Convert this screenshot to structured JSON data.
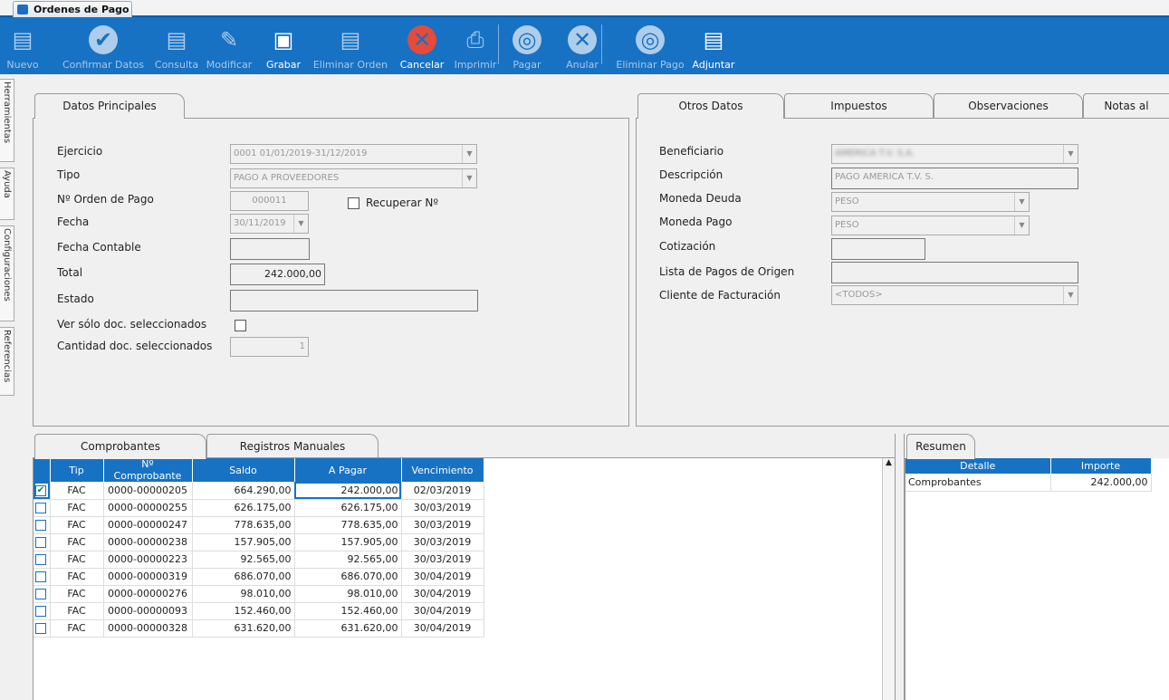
{
  "window": {
    "doc_tab": "Ordenes de Pago"
  },
  "toolbar": [
    {
      "label": "Nuevo",
      "icon": "new-doc-icon",
      "glyph": "▤",
      "enabled": false
    },
    {
      "label": "Confirmar Datos",
      "icon": "check-icon",
      "glyph": "✔",
      "enabled": false
    },
    {
      "label": "Consulta",
      "icon": "query-doc-icon",
      "glyph": "▤",
      "enabled": false
    },
    {
      "label": "Modificar",
      "icon": "edit-icon",
      "glyph": "✎",
      "enabled": false
    },
    {
      "label": "Grabar",
      "icon": "save-icon",
      "glyph": "▣",
      "enabled": true
    },
    {
      "label": "Eliminar Orden",
      "icon": "delete-doc-icon",
      "glyph": "▤",
      "enabled": false
    },
    {
      "label": "Cancelar",
      "icon": "cancel-icon",
      "glyph": "✕",
      "enabled": true
    },
    {
      "label": "Imprimir",
      "icon": "print-icon",
      "glyph": "⎙",
      "enabled": false
    },
    {
      "label": "Pagar",
      "icon": "coins-icon",
      "glyph": "◎",
      "enabled": false
    },
    {
      "label": "Anular",
      "icon": "void-icon",
      "glyph": "✕",
      "enabled": false
    },
    {
      "label": "Eliminar Pago",
      "icon": "delete-pay-icon",
      "glyph": "◎",
      "enabled": false
    },
    {
      "label": "Adjuntar",
      "icon": "attach-icon",
      "glyph": "▤",
      "enabled": true
    }
  ],
  "side_tabs": [
    "Herramientas",
    "Ayuda",
    "Configuraciones",
    "Referencias"
  ],
  "left_panel": {
    "tab": "Datos Principales",
    "labels": {
      "ejercicio": "Ejercicio",
      "tipo": "Tipo",
      "nro": "Nº Orden de Pago",
      "fecha": "Fecha",
      "fecha_contable": "Fecha Contable",
      "total": "Total",
      "estado": "Estado",
      "ver_solo": "Ver sólo doc. seleccionados",
      "cantidad": "Cantidad doc. seleccionados",
      "recuperar": "Recuperar Nº"
    },
    "values": {
      "ejercicio": "0001 01/01/2019-31/12/2019",
      "tipo": "PAGO A PROVEEDORES",
      "nro": "000011",
      "fecha": "30/11/2019",
      "fecha_contable": "",
      "total": "242.000,00",
      "estado": "",
      "cantidad": "1"
    }
  },
  "right_panel": {
    "tabs": [
      "Otros Datos",
      "Impuestos",
      "Observaciones",
      "Notas al"
    ],
    "labels": {
      "beneficiario": "Beneficiario",
      "descripcion": "Descripción",
      "moneda_deuda": "Moneda Deuda",
      "moneda_pago": "Moneda Pago",
      "cotizacion": "Cotización",
      "lista": "Lista de Pagos de Origen",
      "cliente": "Cliente de Facturación"
    },
    "values": {
      "beneficiario": "AMERICA T.V. S.A.",
      "descripcion": "PAGO AMERICA T.V. S.",
      "moneda_deuda": "PESO",
      "moneda_pago": "PESO",
      "cotizacion": "",
      "lista": "",
      "cliente": "<TODOS>"
    }
  },
  "bottom_tabs": [
    "Comprobantes",
    "Registros Manuales"
  ],
  "grid": {
    "columns": [
      "Tip",
      "Nº Comprobante",
      "Saldo",
      "A Pagar",
      "Vencimiento"
    ],
    "rows": [
      {
        "checked": true,
        "tip": "FAC",
        "nro": "0000-00000205",
        "saldo": "664.290,00",
        "apagar": "242.000,00",
        "venc": "02/03/2019"
      },
      {
        "checked": false,
        "tip": "FAC",
        "nro": "0000-00000255",
        "saldo": "626.175,00",
        "apagar": "626.175,00",
        "venc": "30/03/2019"
      },
      {
        "checked": false,
        "tip": "FAC",
        "nro": "0000-00000247",
        "saldo": "778.635,00",
        "apagar": "778.635,00",
        "venc": "30/03/2019"
      },
      {
        "checked": false,
        "tip": "FAC",
        "nro": "0000-00000238",
        "saldo": "157.905,00",
        "apagar": "157.905,00",
        "venc": "30/03/2019"
      },
      {
        "checked": false,
        "tip": "FAC",
        "nro": "0000-00000223",
        "saldo": "92.565,00",
        "apagar": "92.565,00",
        "venc": "30/03/2019"
      },
      {
        "checked": false,
        "tip": "FAC",
        "nro": "0000-00000319",
        "saldo": "686.070,00",
        "apagar": "686.070,00",
        "venc": "30/04/2019"
      },
      {
        "checked": false,
        "tip": "FAC",
        "nro": "0000-00000276",
        "saldo": "98.010,00",
        "apagar": "98.010,00",
        "venc": "30/04/2019"
      },
      {
        "checked": false,
        "tip": "FAC",
        "nro": "0000-00000093",
        "saldo": "152.460,00",
        "apagar": "152.460,00",
        "venc": "30/04/2019"
      },
      {
        "checked": false,
        "tip": "FAC",
        "nro": "0000-00000328",
        "saldo": "631.620,00",
        "apagar": "631.620,00",
        "venc": "30/04/2019"
      }
    ]
  },
  "resumen": {
    "tab": "Resumen",
    "columns": [
      "Detalle",
      "Importe"
    ],
    "rows": [
      {
        "detalle": "Comprobantes",
        "importe": "242.000,00"
      }
    ]
  }
}
